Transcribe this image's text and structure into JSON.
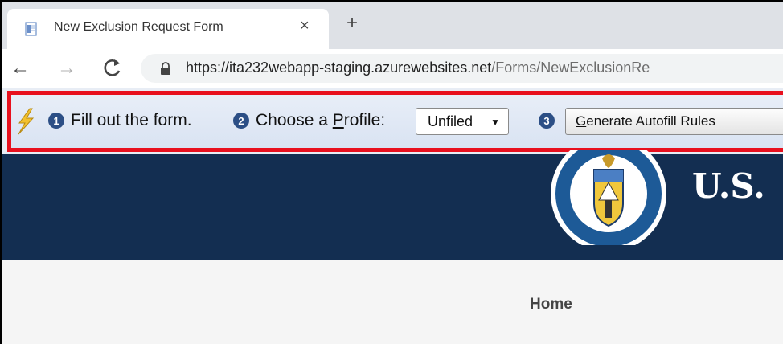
{
  "browser": {
    "tab": {
      "title": "New Exclusion Request Form",
      "close_glyph": "×",
      "favicon": "document-icon"
    },
    "new_tab_glyph": "+",
    "nav": {
      "back": "←",
      "forward": "→",
      "reload": "C"
    },
    "url": {
      "host": "https://ita232webapp-staging.azurewebsites.net",
      "path": "/Forms/NewExclusionRe"
    }
  },
  "extension": {
    "icon": "lightning-bolt-icon",
    "step1": {
      "num": "1",
      "label": "Fill out the form."
    },
    "step2": {
      "num": "2",
      "label_pre": "Choose a ",
      "label_key": "P",
      "label_post": "rofile:"
    },
    "profile_select": {
      "value": "Unfiled",
      "arrow": "▼"
    },
    "step3": {
      "num": "3"
    },
    "generate_button": {
      "key": "G",
      "rest": "enerate Autofill Rules"
    },
    "highlight_color": "#e8101e"
  },
  "site": {
    "title": "U.S.",
    "header_color": "#132e51",
    "nav": {
      "home": "Home"
    }
  }
}
